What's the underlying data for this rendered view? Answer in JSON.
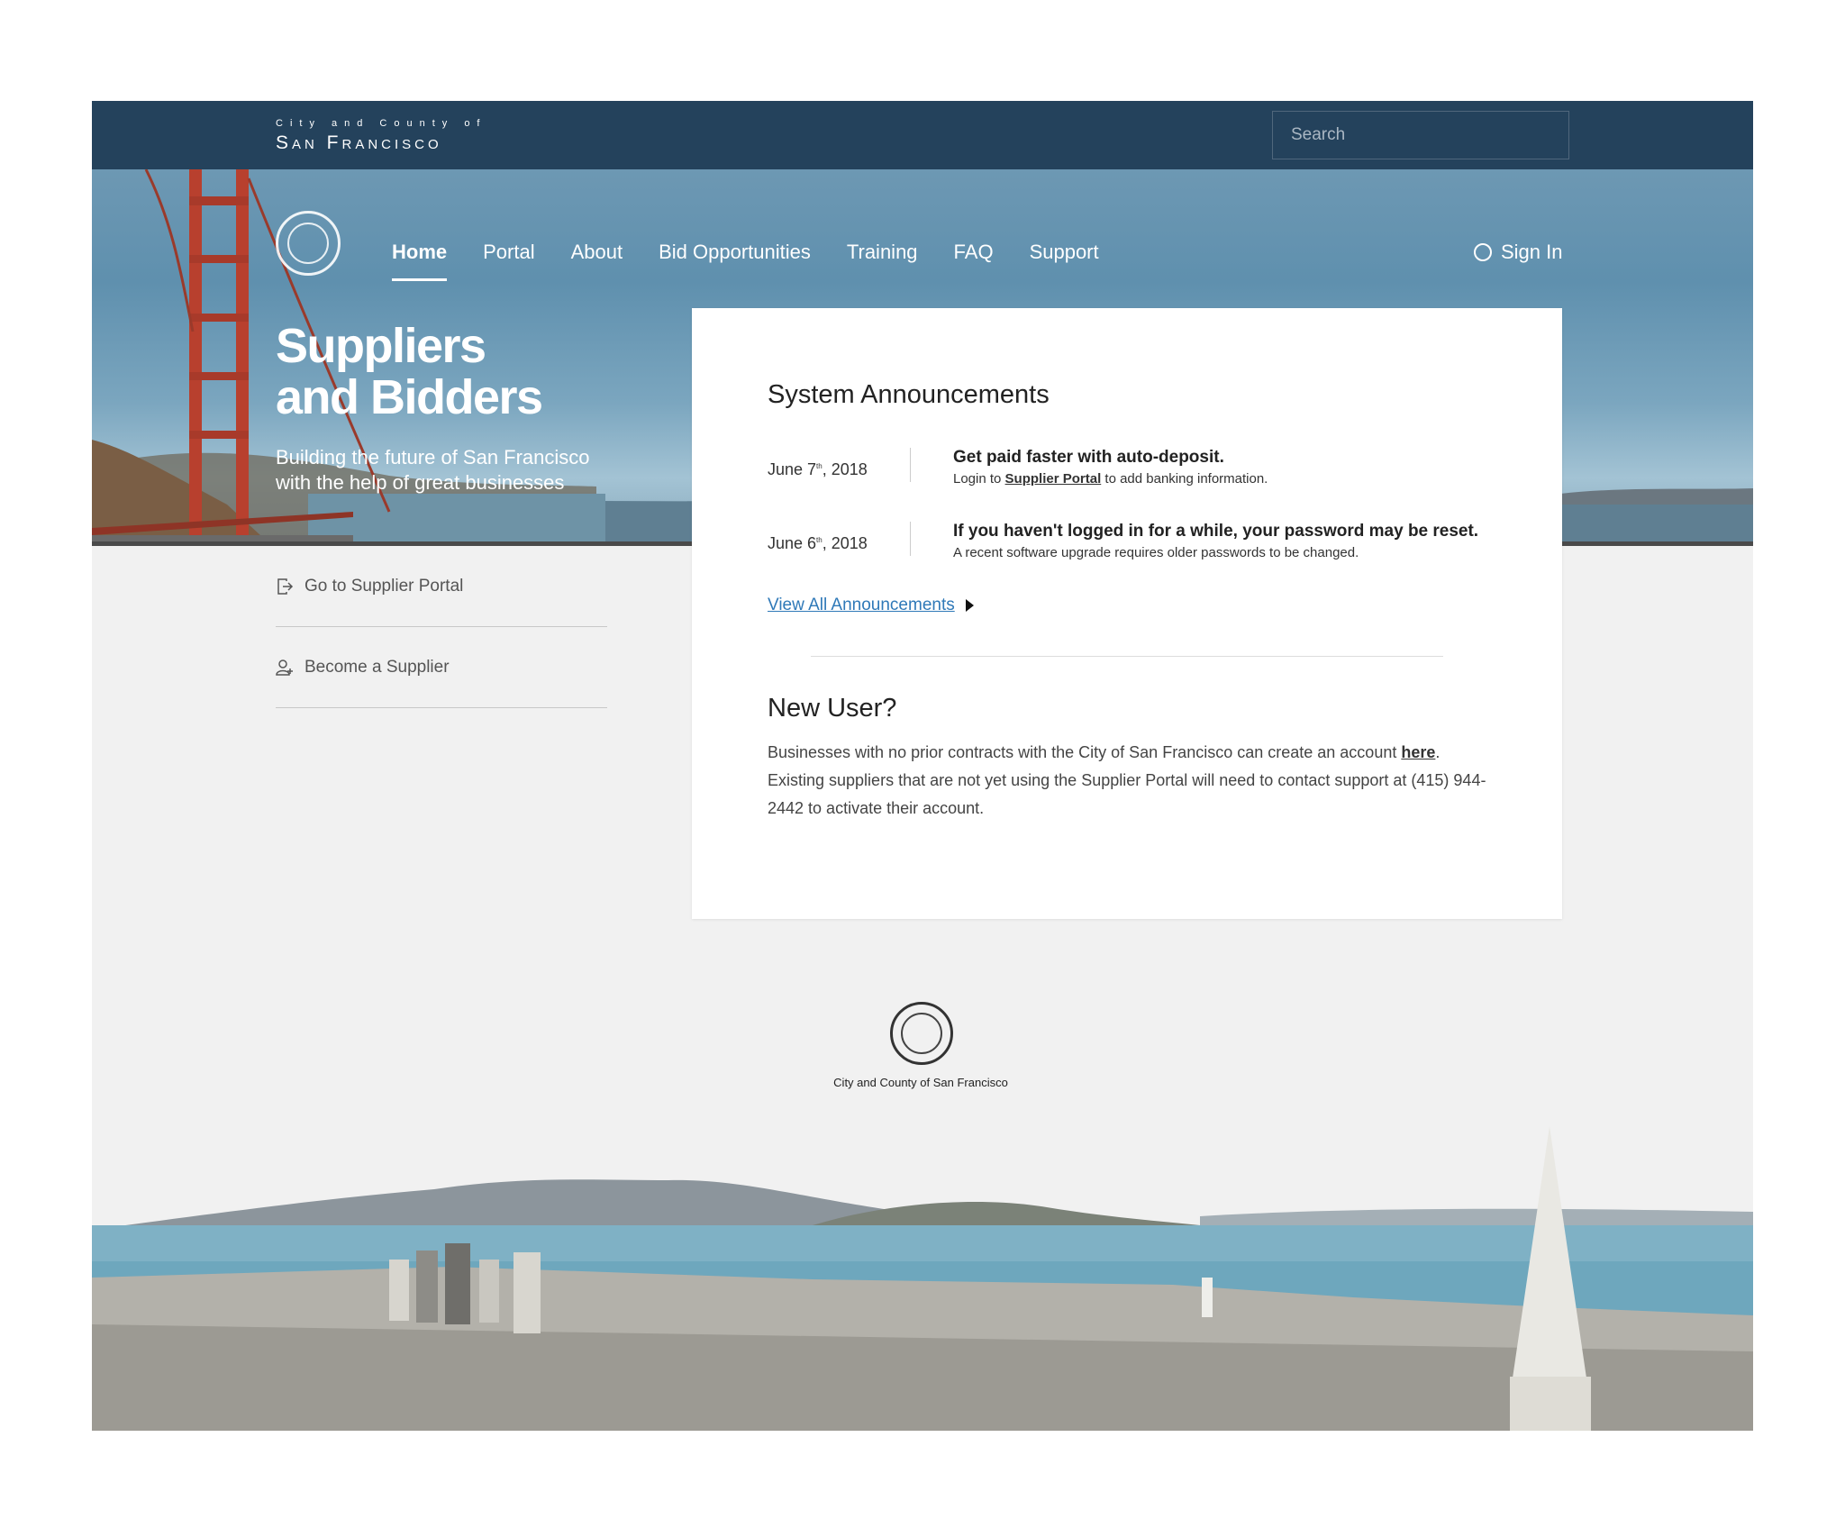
{
  "header": {
    "brand_small": "City and County of",
    "brand_big": "San Francisco",
    "search_placeholder": "Search"
  },
  "nav": {
    "items": [
      "Home",
      "Portal",
      "About",
      "Bid Opportunities",
      "Training",
      "FAQ",
      "Support"
    ],
    "active": "Home",
    "sign_in": "Sign In"
  },
  "hero": {
    "title_line1": "Suppliers",
    "title_line2": "and Bidders",
    "subtitle_line1": "Building the future of San Francisco",
    "subtitle_line2": "with the help of great businesses"
  },
  "sidebar": {
    "links": [
      {
        "label": "Go to Supplier Portal",
        "icon": "exit-icon"
      },
      {
        "label": "Become a Supplier",
        "icon": "user-add-icon"
      }
    ]
  },
  "announcements": {
    "heading": "System Announcements",
    "items": [
      {
        "date_prefix": "June 7",
        "date_suffix": "th",
        "date_year": ", 2018",
        "title": "Get paid faster with auto-deposit.",
        "desc_before": "Login to ",
        "desc_link": "Supplier Portal",
        "desc_after": " to add banking information."
      },
      {
        "date_prefix": "June 6",
        "date_suffix": "th",
        "date_year": ", 2018",
        "title": "If you haven't logged in for a while, your password may be reset.",
        "desc": "A recent software upgrade requires older passwords to be changed."
      }
    ],
    "view_all": "View All Announcements"
  },
  "new_user": {
    "heading": "New User?",
    "text_before": "Businesses with no prior contracts with the City of San Francisco can create an account ",
    "link": "here",
    "text_after": ". Existing suppliers that are not yet using the Supplier Portal will need to contact support at (415) 944-2442 to activate their account."
  },
  "footer": {
    "caption": "City and County of San Francisco"
  },
  "colors": {
    "topbar": "#24425c",
    "link": "#2f79b8",
    "page_bg": "#f1f1f1"
  }
}
